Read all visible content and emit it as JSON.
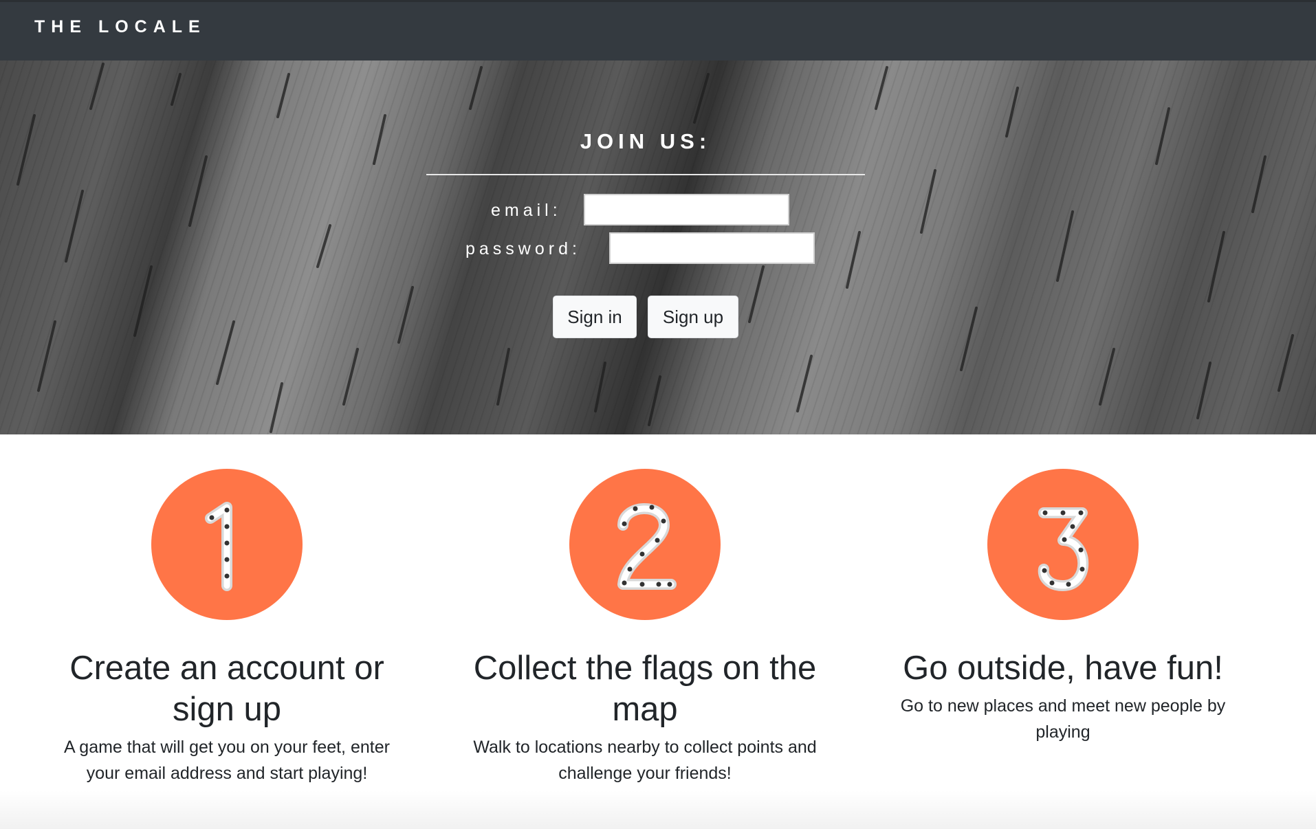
{
  "navbar": {
    "brand": "THE LOCALE"
  },
  "hero": {
    "title": "JOIN US:",
    "email_label": "email:",
    "email_value": "",
    "password_label": "password:",
    "password_value": "",
    "signin_label": "Sign in",
    "signup_label": "Sign up"
  },
  "steps": [
    {
      "number": "1",
      "icon": "chain-number-1-icon",
      "heading": "Create an account or sign up",
      "text": "A game that will get you on your feet, enter your email address and start playing!"
    },
    {
      "number": "2",
      "icon": "chain-number-2-icon",
      "heading": "Collect the flags on the map",
      "text": "Walk to locations nearby to collect points and challenge your friends!"
    },
    {
      "number": "3",
      "icon": "chain-number-3-icon",
      "heading": "Go outside, have fun!",
      "text": "Go to new places and meet new people by playing"
    }
  ],
  "colors": {
    "navbar": "#343a40",
    "circle": "#ff7547",
    "button": "#f8f9fa"
  }
}
